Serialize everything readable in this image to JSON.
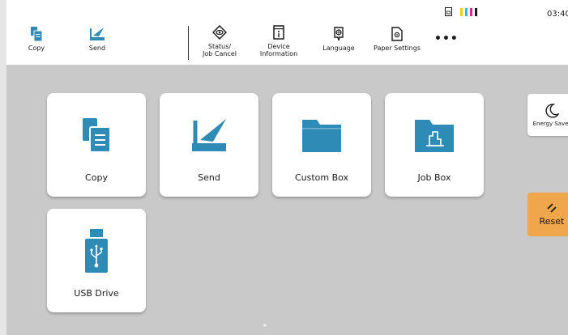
{
  "header": {
    "quick": [
      {
        "label": "Copy"
      },
      {
        "label": "Send"
      }
    ],
    "tools": [
      {
        "label_line1": "Status/",
        "label_line2": "Job Cancel"
      },
      {
        "label_line1": "Device",
        "label_line2": "Information"
      },
      {
        "label_line1": "",
        "label_line2": "Language"
      },
      {
        "label_line1": "",
        "label_line2": "Paper Settings"
      }
    ],
    "more": "•••",
    "time": "03:40"
  },
  "tiles": [
    {
      "label": "Copy"
    },
    {
      "label": "Send"
    },
    {
      "label": "Custom Box"
    },
    {
      "label": "Job Box"
    },
    {
      "label": "USB Drive"
    }
  ],
  "side": {
    "energy_saver": "Energy Saver",
    "reset": "Reset"
  },
  "colors": {
    "accent": "#2e8bb6",
    "reset": "#f0a64a",
    "toner": [
      "#28c0e0",
      "#e0288c",
      "#f0d000",
      "#1a1a1a"
    ]
  }
}
